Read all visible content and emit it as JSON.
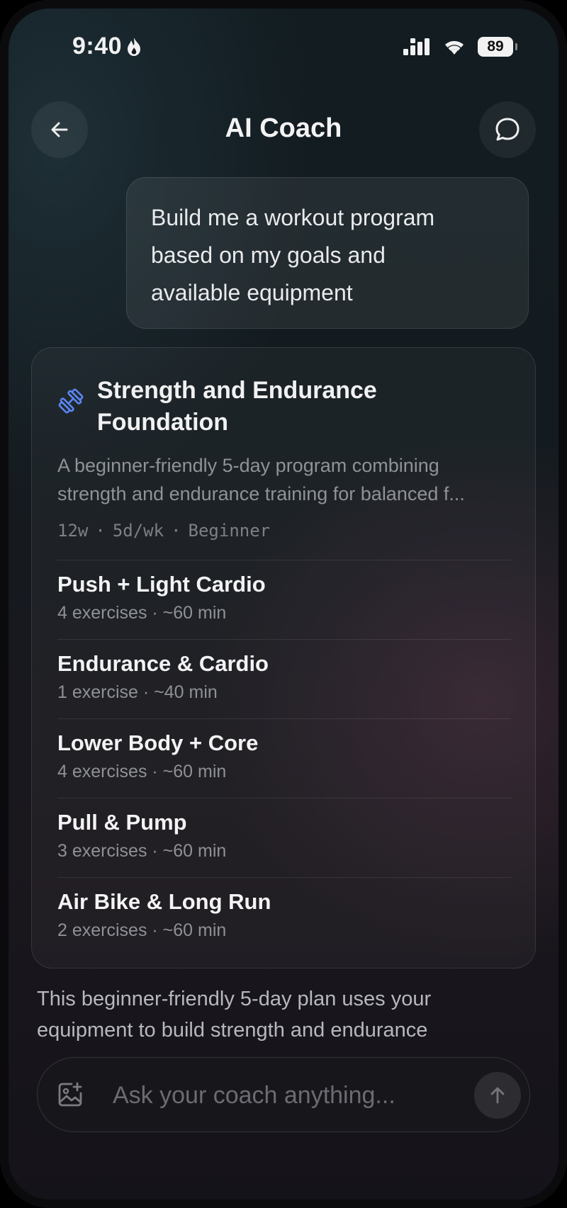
{
  "status_bar": {
    "time": "9:40",
    "battery": "89"
  },
  "header": {
    "title": "AI Coach",
    "back_icon": "arrow-left-icon",
    "chat_icon": "chat-bubble-icon"
  },
  "user_message": {
    "lines": [
      "Build me a workout program",
      "based on my goals and",
      "available equipment"
    ]
  },
  "plan": {
    "icon": "dumbbell-icon",
    "title_lines": [
      "Strength and Endurance",
      "Foundation"
    ],
    "description_lines": [
      "A beginner-friendly 5-day program combining",
      "strength and endurance training for balanced f..."
    ],
    "meta": {
      "duration": "12w",
      "frequency": "5d/wk",
      "level": "Beginner",
      "separator": "·"
    },
    "workouts": [
      {
        "name": "Push + Light Cardio",
        "detail": "4 exercises · ~60 min"
      },
      {
        "name": "Endurance & Cardio",
        "detail": "1 exercise · ~40 min"
      },
      {
        "name": "Lower Body + Core",
        "detail": "4 exercises · ~60 min"
      },
      {
        "name": "Pull & Pump",
        "detail": "3 exercises · ~60 min"
      },
      {
        "name": "Air Bike & Long Run",
        "detail": "2 exercises · ~60 min"
      }
    ]
  },
  "assistant_message": {
    "lines": [
      "This beginner-friendly 5-day plan uses your",
      "equipment to build strength and endurance"
    ]
  },
  "composer": {
    "placeholder": "Ask your coach anything...",
    "attach_icon": "image-add-icon",
    "send_icon": "arrow-up-icon"
  },
  "colors": {
    "accent_icon": "#5b84f0"
  }
}
